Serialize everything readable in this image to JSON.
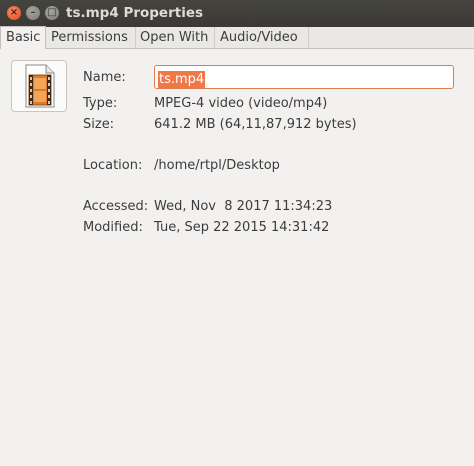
{
  "window": {
    "title": "ts.mp4 Properties",
    "close_glyph": "×",
    "minimize_glyph": "–",
    "maximize_glyph": "□"
  },
  "tabs": [
    {
      "label": "Basic",
      "active": true
    },
    {
      "label": "Permissions",
      "active": false
    },
    {
      "label": "Open With",
      "active": false
    },
    {
      "label": "Audio/Video",
      "active": false
    }
  ],
  "file_icon": "video-file-icon",
  "colors": {
    "selection": "#f07746",
    "input_border": "#e27b52",
    "titlebar": "#3c3b37",
    "background": "#f2f1f0"
  },
  "basic": {
    "name_label": "Name:",
    "name_value": "ts.mp4",
    "type_label": "Type:",
    "type_value": "MPEG-4 video (video/mp4)",
    "size_label": "Size:",
    "size_value": "641.2 MB (64,11,87,912 bytes)",
    "location_label": "Location:",
    "location_value": "/home/rtpl/Desktop",
    "accessed_label": "Accessed:",
    "accessed_value": "Wed, Nov  8 2017 11:34:23",
    "modified_label": "Modified:",
    "modified_value": "Tue, Sep 22 2015 14:31:42"
  }
}
